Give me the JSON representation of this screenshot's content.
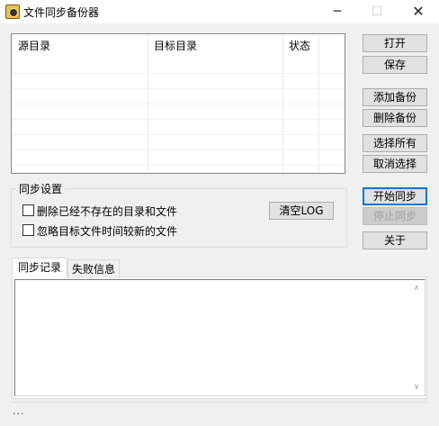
{
  "window": {
    "title": "文件同步备份器",
    "minimize_glyph": "─",
    "maximize_glyph": "☐",
    "close_glyph": "✕"
  },
  "list": {
    "columns": [
      "源目录",
      "目标目录",
      "状态"
    ],
    "rows": []
  },
  "buttons": {
    "open": "打开",
    "save": "保存",
    "add_backup": "添加备份",
    "delete_backup": "删除备份",
    "select_all": "选择所有",
    "deselect": "取消选择",
    "start_sync": "开始同步",
    "stop_sync": "停止同步",
    "about": "关于",
    "clear_log": "清空LOG"
  },
  "sync_settings": {
    "group_label": "同步设置",
    "delete_missing": {
      "label": "删除已经不存在的目录和文件",
      "checked": false
    },
    "ignore_newer": {
      "label": "忽略目标文件时间较新的文件",
      "checked": false
    }
  },
  "tabs": [
    {
      "label": "同步记录",
      "active": true
    },
    {
      "label": "失败信息",
      "active": false
    }
  ],
  "status": {
    "text": "..."
  },
  "colors": {
    "accent": "#0078d7",
    "background": "#f0f0f0"
  }
}
